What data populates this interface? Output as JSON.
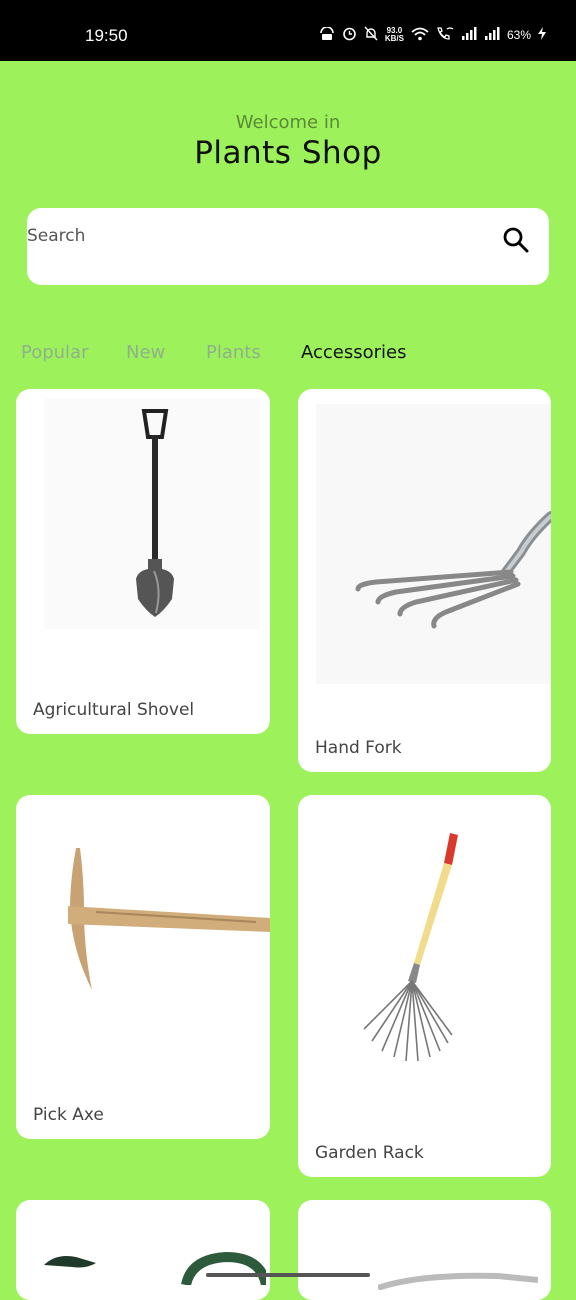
{
  "status_bar": {
    "time": "19:50",
    "net_speed_value": "93.0",
    "net_speed_unit": "KB/S",
    "battery": "63%",
    "icons": [
      "vpn-icon",
      "alarm-icon",
      "mute-icon",
      "wifi-icon",
      "wifi-calling-icon",
      "signal-icon",
      "signal-icon",
      "charging-icon"
    ]
  },
  "header": {
    "welcome": "Welcome in",
    "title": "Plants Shop"
  },
  "search": {
    "placeholder": "Search",
    "icon": "search-icon"
  },
  "tabs": [
    {
      "label": "Popular",
      "active": false
    },
    {
      "label": "New",
      "active": false
    },
    {
      "label": "Plants",
      "active": false
    },
    {
      "label": "Accessories",
      "active": true
    }
  ],
  "products": [
    {
      "name": "Agricultural Shovel",
      "image": "shovel-image"
    },
    {
      "name": "Hand Fork",
      "image": "hand-fork-image"
    },
    {
      "name": "Pick Axe",
      "image": "pick-axe-image"
    },
    {
      "name": "Garden Rack",
      "image": "garden-rake-image"
    },
    {
      "name": "",
      "image": "watering-can-image"
    },
    {
      "name": "",
      "image": "tool-image"
    }
  ],
  "colors": {
    "background": "#9df25b",
    "card": "#ffffff",
    "active_tab": "#111111",
    "inactive_tab": "#8fb08a"
  }
}
